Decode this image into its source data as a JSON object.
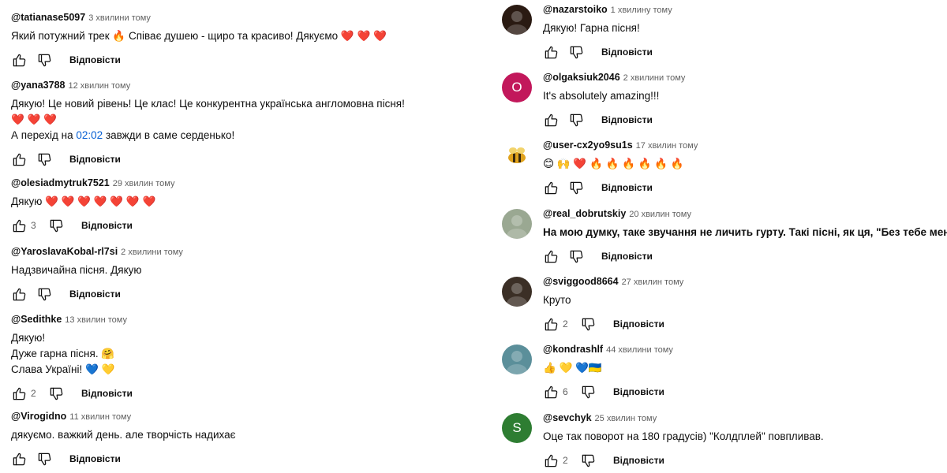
{
  "left_comments": [
    {
      "author": "@tatianase5097",
      "time": "3 хвилини тому",
      "lines": [
        "Який потужний трек 🔥 Співає душею - щиро та красиво! Дякуємо ❤️ ❤️ ❤️"
      ],
      "likes": "",
      "reply": "Відповісти"
    },
    {
      "author": "@yana3788",
      "time": "12 хвилин тому",
      "lines": [
        "Дякую! Це новий рівень! Це клас! Це конкурентна українська англомовна пісня!",
        "❤️ ❤️ ❤️"
      ],
      "timestamp_line_prefix": "А перехід на ",
      "timestamp": "02:02",
      "timestamp_line_suffix": " завжди в саме серденько!",
      "likes": "",
      "reply": "Відповісти"
    },
    {
      "author": "@olesiadmytruk7521",
      "time": "29 хвилин тому",
      "lines": [
        "Дякую ❤️ ❤️ ❤️ ❤️ ❤️ ❤️ ❤️"
      ],
      "likes": "3",
      "reply": "Відповісти"
    },
    {
      "author": "@YaroslavaKobal-rl7si",
      "time": "2 хвилини тому",
      "lines": [
        "Надзвичайна пісня. Дякую"
      ],
      "likes": "",
      "reply": "Відповісти"
    },
    {
      "author": "@Sedithke",
      "time": "13 хвилин тому",
      "lines": [
        "Дякую!",
        "Дуже гарна пісня. 🤗",
        "Слава Україні! 💙 💛"
      ],
      "likes": "2",
      "reply": "Відповісти"
    },
    {
      "author": "@Virogidno",
      "time": "11 хвилин тому",
      "lines": [
        "дякуємо. важкий день. але творчість надихає"
      ],
      "likes": "",
      "reply": "Відповісти"
    }
  ],
  "right_comments": [
    {
      "author": "@nazarstoiko",
      "time": "1 хвилину тому",
      "lines": [
        "Дякую! Гарна пісня!"
      ],
      "likes": "",
      "reply": "Відповісти",
      "avatar_color": "#2a1a12",
      "avatar_letter": ""
    },
    {
      "author": "@olgaksiuk2046",
      "time": "2 хвилини тому",
      "lines": [
        "It's absolutely amazing!!!"
      ],
      "likes": "",
      "reply": "Відповісти",
      "avatar_color": "#c2185b",
      "avatar_letter": "O"
    },
    {
      "author": "@user-cx2yo9su1s",
      "time": "17 хвилин тому",
      "lines": [
        "😊 🙌 ❤️ 🔥 🔥 🔥 🔥 🔥 🔥"
      ],
      "likes": "",
      "reply": "Відповісти",
      "avatar_color": "#ffffff",
      "avatar_letter": ""
    },
    {
      "author": "@real_dobrutskiy",
      "time": "20 хвилин тому",
      "lines": [
        "На мою думку, таке звучання не личить гурту. Такі пісні, як ця, \"Без тебе мене нема\""
      ],
      "likes": "",
      "reply": "Відповісти",
      "avatar_color": "#9aa892",
      "avatar_letter": "",
      "bold": true
    },
    {
      "author": "@sviggood8664",
      "time": "27 хвилин тому",
      "lines": [
        "Круто"
      ],
      "likes": "2",
      "reply": "Відповісти",
      "avatar_color": "#3b2f26",
      "avatar_letter": ""
    },
    {
      "author": "@kondrashlf",
      "time": "44 хвилини тому",
      "lines": [
        "👍 💛 💙🇺🇦"
      ],
      "likes": "6",
      "reply": "Відповісти",
      "avatar_color": "#5b8f9a",
      "avatar_letter": ""
    },
    {
      "author": "@sevchyk",
      "time": "25 хвилин тому",
      "lines": [
        "Оце так поворот на 180 градусів) \"Колдплей\" повпливав."
      ],
      "likes": "2",
      "reply": "Відповісти",
      "avatar_color": "#2e7d32",
      "avatar_letter": "S"
    }
  ],
  "icons": {
    "like": "thumbs-up-icon",
    "dislike": "thumbs-down-icon"
  }
}
